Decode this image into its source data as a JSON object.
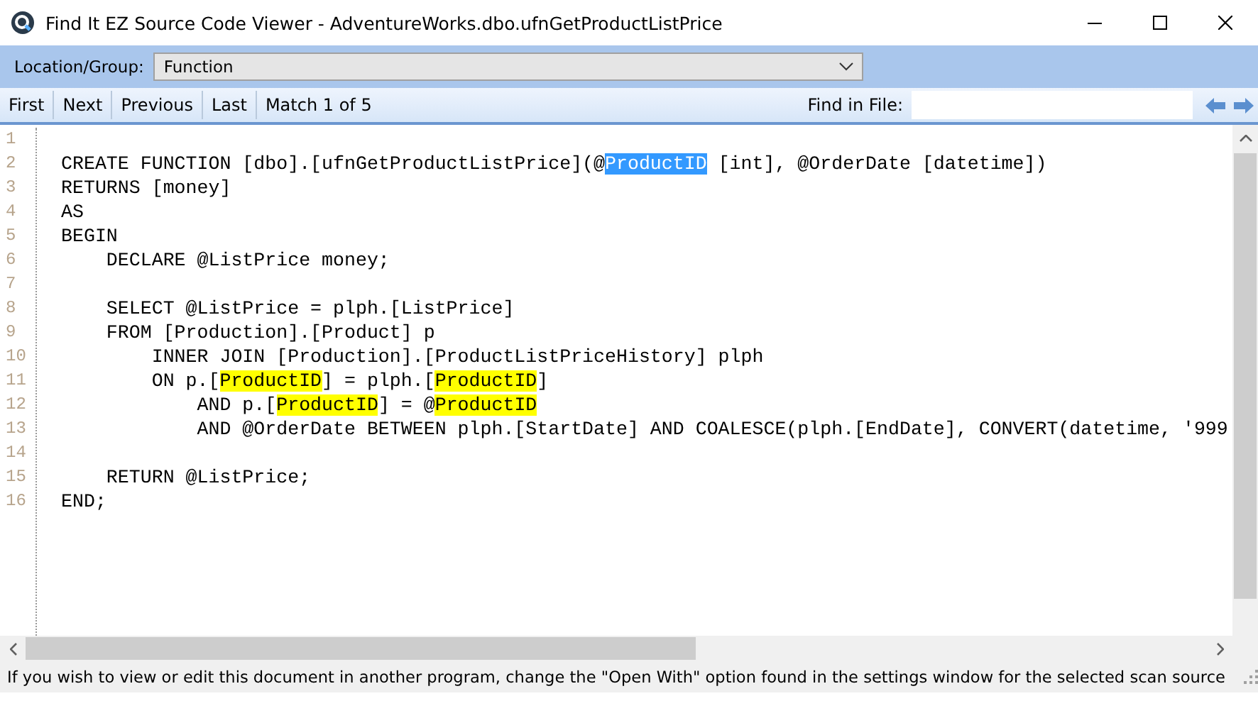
{
  "window": {
    "title": "Find It EZ Source Code Viewer - AdventureWorks.dbo.ufnGetProductListPrice"
  },
  "location": {
    "label": "Location/Group:",
    "value": "Function"
  },
  "toolbar": {
    "buttons": [
      "First",
      "Next",
      "Previous",
      "Last"
    ],
    "match_status": "Match 1 of 5",
    "find_label": "Find in File:"
  },
  "code": {
    "lines": [
      {
        "number": "1"
      },
      {
        "number": "2",
        "segments": [
          {
            "kind": "plain",
            "text": "CREATE FUNCTION [dbo].[ufnGetProductListPrice](@"
          },
          {
            "kind": "current",
            "text": "ProductID"
          },
          {
            "kind": "plain",
            "text": " [int], @OrderDate [datetime])"
          }
        ]
      },
      {
        "number": "3",
        "segments": [
          {
            "kind": "plain",
            "text": "RETURNS [money]"
          }
        ]
      },
      {
        "number": "4",
        "segments": [
          {
            "kind": "plain",
            "text": "AS"
          }
        ]
      },
      {
        "number": "5",
        "segments": [
          {
            "kind": "plain",
            "text": "BEGIN"
          }
        ]
      },
      {
        "number": "6",
        "segments": [
          {
            "kind": "plain",
            "text": "    DECLARE @ListPrice money;"
          }
        ]
      },
      {
        "number": "7"
      },
      {
        "number": "8",
        "segments": [
          {
            "kind": "plain",
            "text": "    SELECT @ListPrice = plph.[ListPrice]"
          }
        ]
      },
      {
        "number": "9",
        "segments": [
          {
            "kind": "plain",
            "text": "    FROM [Production].[Product] p"
          }
        ]
      },
      {
        "number": "10",
        "segments": [
          {
            "kind": "plain",
            "text": "        INNER JOIN [Production].[ProductListPriceHistory] plph"
          }
        ]
      },
      {
        "number": "11",
        "segments": [
          {
            "kind": "plain",
            "text": "        ON p.["
          },
          {
            "kind": "match",
            "text": "ProductID"
          },
          {
            "kind": "plain",
            "text": "] = plph.["
          },
          {
            "kind": "match",
            "text": "ProductID"
          },
          {
            "kind": "plain",
            "text": "]"
          }
        ]
      },
      {
        "number": "12",
        "segments": [
          {
            "kind": "plain",
            "text": "            AND p.["
          },
          {
            "kind": "match",
            "text": "ProductID"
          },
          {
            "kind": "plain",
            "text": "] = @"
          },
          {
            "kind": "match",
            "text": "ProductID"
          }
        ]
      },
      {
        "number": "13",
        "segments": [
          {
            "kind": "plain",
            "text": "            AND @OrderDate BETWEEN plph.[StartDate] AND COALESCE(plph.[EndDate], CONVERT(datetime, '999"
          }
        ]
      },
      {
        "number": "14"
      },
      {
        "number": "15",
        "segments": [
          {
            "kind": "plain",
            "text": "    RETURN @ListPrice;"
          }
        ]
      },
      {
        "number": "16",
        "segments": [
          {
            "kind": "plain",
            "text": "END;"
          }
        ]
      }
    ]
  },
  "status_bar": {
    "text": "If you wish to view or edit this document in another program, change the \"Open With\" option found in the settings window for the selected scan source"
  }
}
